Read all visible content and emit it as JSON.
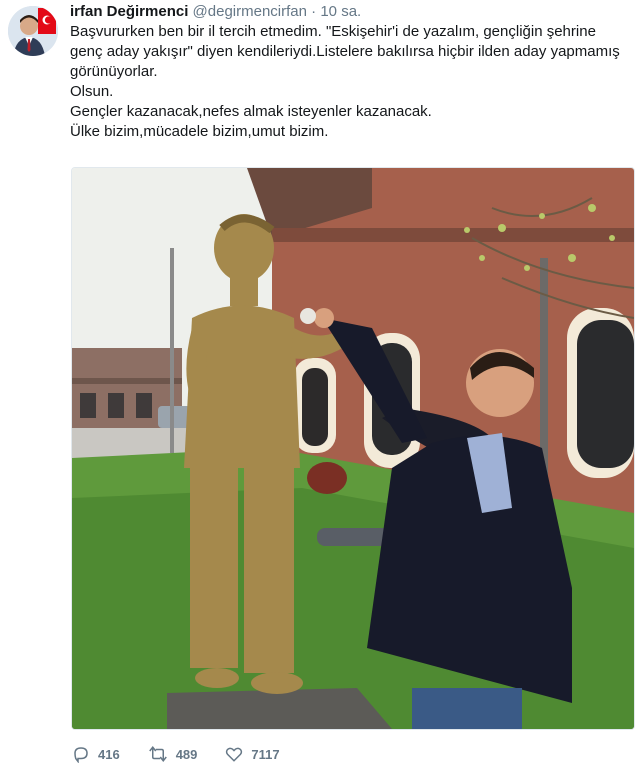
{
  "tweet": {
    "author_name": "irfan Değirmenci",
    "author_handle": "@degirmencirfan",
    "separator": "·",
    "time": "10 sa.",
    "lines": [
      "Başvururken ben bir il tercih etmedim. \"Eskişehir'i de yazalım, gençliğin şehrine genç aday yakışır\" diyen kendileriydi.Listelere bakılırsa  hiçbir ilden aday yapmamış görünüyorlar.",
      "Olsun.",
      "Gençler kazanacak,nefes almak isteyenler kazanacak.",
      "Ülke bizim,mücadele bizim,umut bizim."
    ]
  },
  "actions": {
    "reply_icon": "reply-icon",
    "reply_count": "416",
    "retweet_icon": "retweet-icon",
    "retweet_count": "489",
    "like_icon": "heart-icon",
    "like_count": "7117"
  },
  "colors": {
    "text": "#14171a",
    "secondary": "#657786",
    "flag_red": "#e30a17"
  }
}
